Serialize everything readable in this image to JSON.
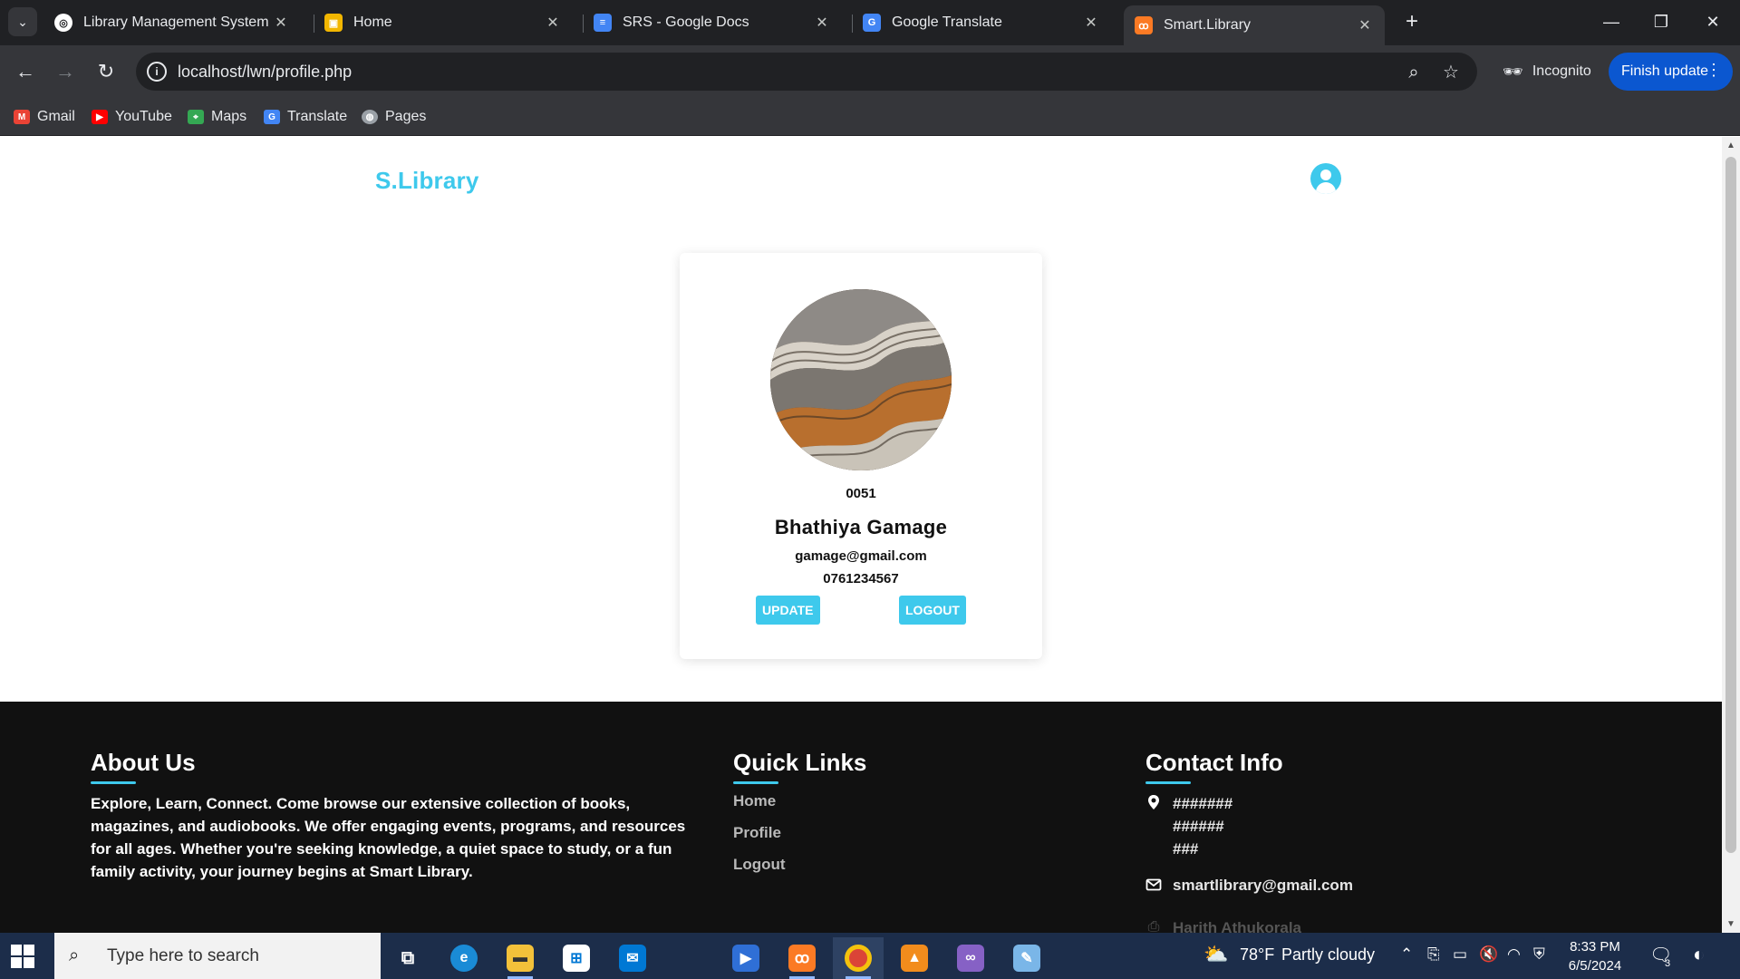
{
  "browser": {
    "tabs": [
      {
        "title": "Library Management System &",
        "icon": "openai-icon",
        "active": false
      },
      {
        "title": "Home",
        "icon": "image-icon",
        "active": false
      },
      {
        "title": "SRS - Google Docs",
        "icon": "docs-icon",
        "active": false
      },
      {
        "title": "Google Translate",
        "icon": "translate-icon",
        "active": false
      },
      {
        "title": "Smart.Library",
        "icon": "xampp-icon",
        "active": true
      }
    ],
    "close_glyph": "✕",
    "new_tab_glyph": "+",
    "url": "localhost/lwn/profile.php",
    "incognito_label": "Incognito",
    "finish_update_label": "Finish update",
    "bookmarks": [
      {
        "label": "Gmail",
        "icon": "gmail-icon",
        "color": "#ea4335"
      },
      {
        "label": "YouTube",
        "icon": "youtube-icon",
        "color": "#ff0000"
      },
      {
        "label": "Maps",
        "icon": "maps-icon",
        "color": "#34a853"
      },
      {
        "label": "Translate",
        "icon": "translate-icon",
        "color": "#4285f4"
      },
      {
        "label": "Pages",
        "icon": "globe-icon",
        "color": "#9aa0a6"
      }
    ]
  },
  "page": {
    "logo": "S.Library",
    "accent_color": "#3ec9ec",
    "profile": {
      "id": "0051",
      "name": "Bhathiya Gamage",
      "email": "gamage@gmail.com",
      "phone": "0761234567",
      "update_label": "UPDATE",
      "logout_label": "LOGOUT"
    },
    "footer": {
      "about": {
        "heading": "About Us",
        "text": "Explore, Learn, Connect. Come browse our extensive collection of books, magazines, and audiobooks. We offer engaging events, programs, and resources for all ages. Whether you're seeking knowledge, a quiet space to study, or a fun family activity, your journey begins at Smart Library."
      },
      "quick_links": {
        "heading": "Quick Links",
        "links": [
          "Home",
          "Profile",
          "Logout"
        ]
      },
      "contact": {
        "heading": "Contact Info",
        "address_lines": [
          "#######",
          "######",
          "###"
        ],
        "email": "smartlibrary@gmail.com",
        "name": "Harith Athukorala"
      }
    }
  },
  "taskbar": {
    "search_placeholder": "Type here to search",
    "weather_temp": "78°F",
    "weather_text": "Partly cloudy",
    "time": "8:33 PM",
    "date": "6/5/2024",
    "notification_count": "3"
  }
}
